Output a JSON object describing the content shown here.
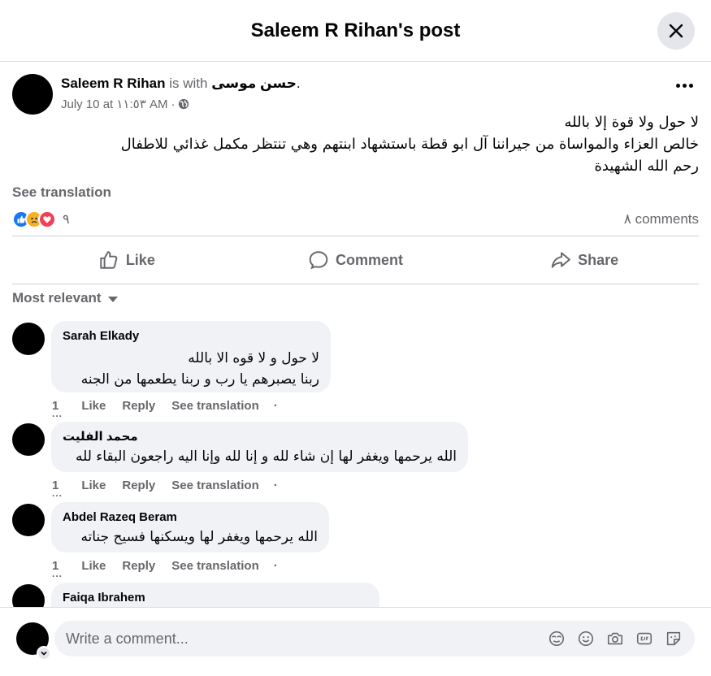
{
  "header": {
    "title": "Saleem R Rihan's post"
  },
  "post": {
    "author": "Saleem R Rihan",
    "with_text": "is with",
    "tagged": "حسن موسى",
    "tagged_suffix": ".",
    "date": "July 10 at ١١:٥٣ AM",
    "date_sep": "·",
    "lines": [
      "لا حول ولا قوة إلا بالله",
      "خالص العزاء والمواساة من جيراننا آل ابو قطة باستشهاد ابنتهم وهي تنتظر مكمل غذائي للاطفال",
      "رحم الله الشهيدة"
    ],
    "see_translation": "See translation",
    "reaction_count": "٩",
    "comments_count": "٨ comments"
  },
  "actions": {
    "like": "Like",
    "comment": "Comment",
    "share": "Share"
  },
  "sort_label": "Most relevant",
  "comments": [
    {
      "name": "Sarah Elkady",
      "lines": [
        "لا حول و لا قوه الا بالله",
        "ربنا يصبرهم يا رب و ربنا يطعمها من الجنه"
      ],
      "time": "1",
      "like": "Like",
      "reply": "Reply",
      "translate": "See translation",
      "sep": "·"
    },
    {
      "name": "محمد الفليت",
      "lines": [
        "الله يرحمها ويغفر لها إن شاء لله و إنا لله وإنا اليه راجعون البقاء لله"
      ],
      "time": "1",
      "like": "Like",
      "reply": "Reply",
      "translate": "See translation",
      "sep": "·"
    },
    {
      "name": "Abdel Razeq Beram",
      "lines": [
        "الله يرحمها ويغفر لها ويسكنها فسيح جناته"
      ],
      "time": "1",
      "like": "Like",
      "reply": "Reply",
      "translate": "See translation",
      "sep": "·"
    },
    {
      "name": "Faiqa Ibrahem",
      "lines": [
        ""
      ],
      "time": "",
      "like": "",
      "reply": "",
      "translate": "",
      "sep": ""
    }
  ],
  "composer": {
    "placeholder": "Write a comment..."
  },
  "icons": {
    "close": "close-icon",
    "more": "more-icon",
    "globe": "globe-icon",
    "like": "like-icon",
    "comment": "comment-icon",
    "share": "share-icon",
    "caret": "caret-down-icon",
    "avatar_menu": "chevron-down-icon",
    "sticker": "avatar-sticker-icon",
    "emoji": "emoji-icon",
    "camera": "camera-icon",
    "gif": "gif-icon",
    "sticker2": "sticker-icon"
  },
  "colors": {
    "accent": "#1877f2",
    "muted": "#65676b",
    "bubble": "#f0f2f5",
    "love": "#f33e58",
    "sad": "#f7b125"
  }
}
